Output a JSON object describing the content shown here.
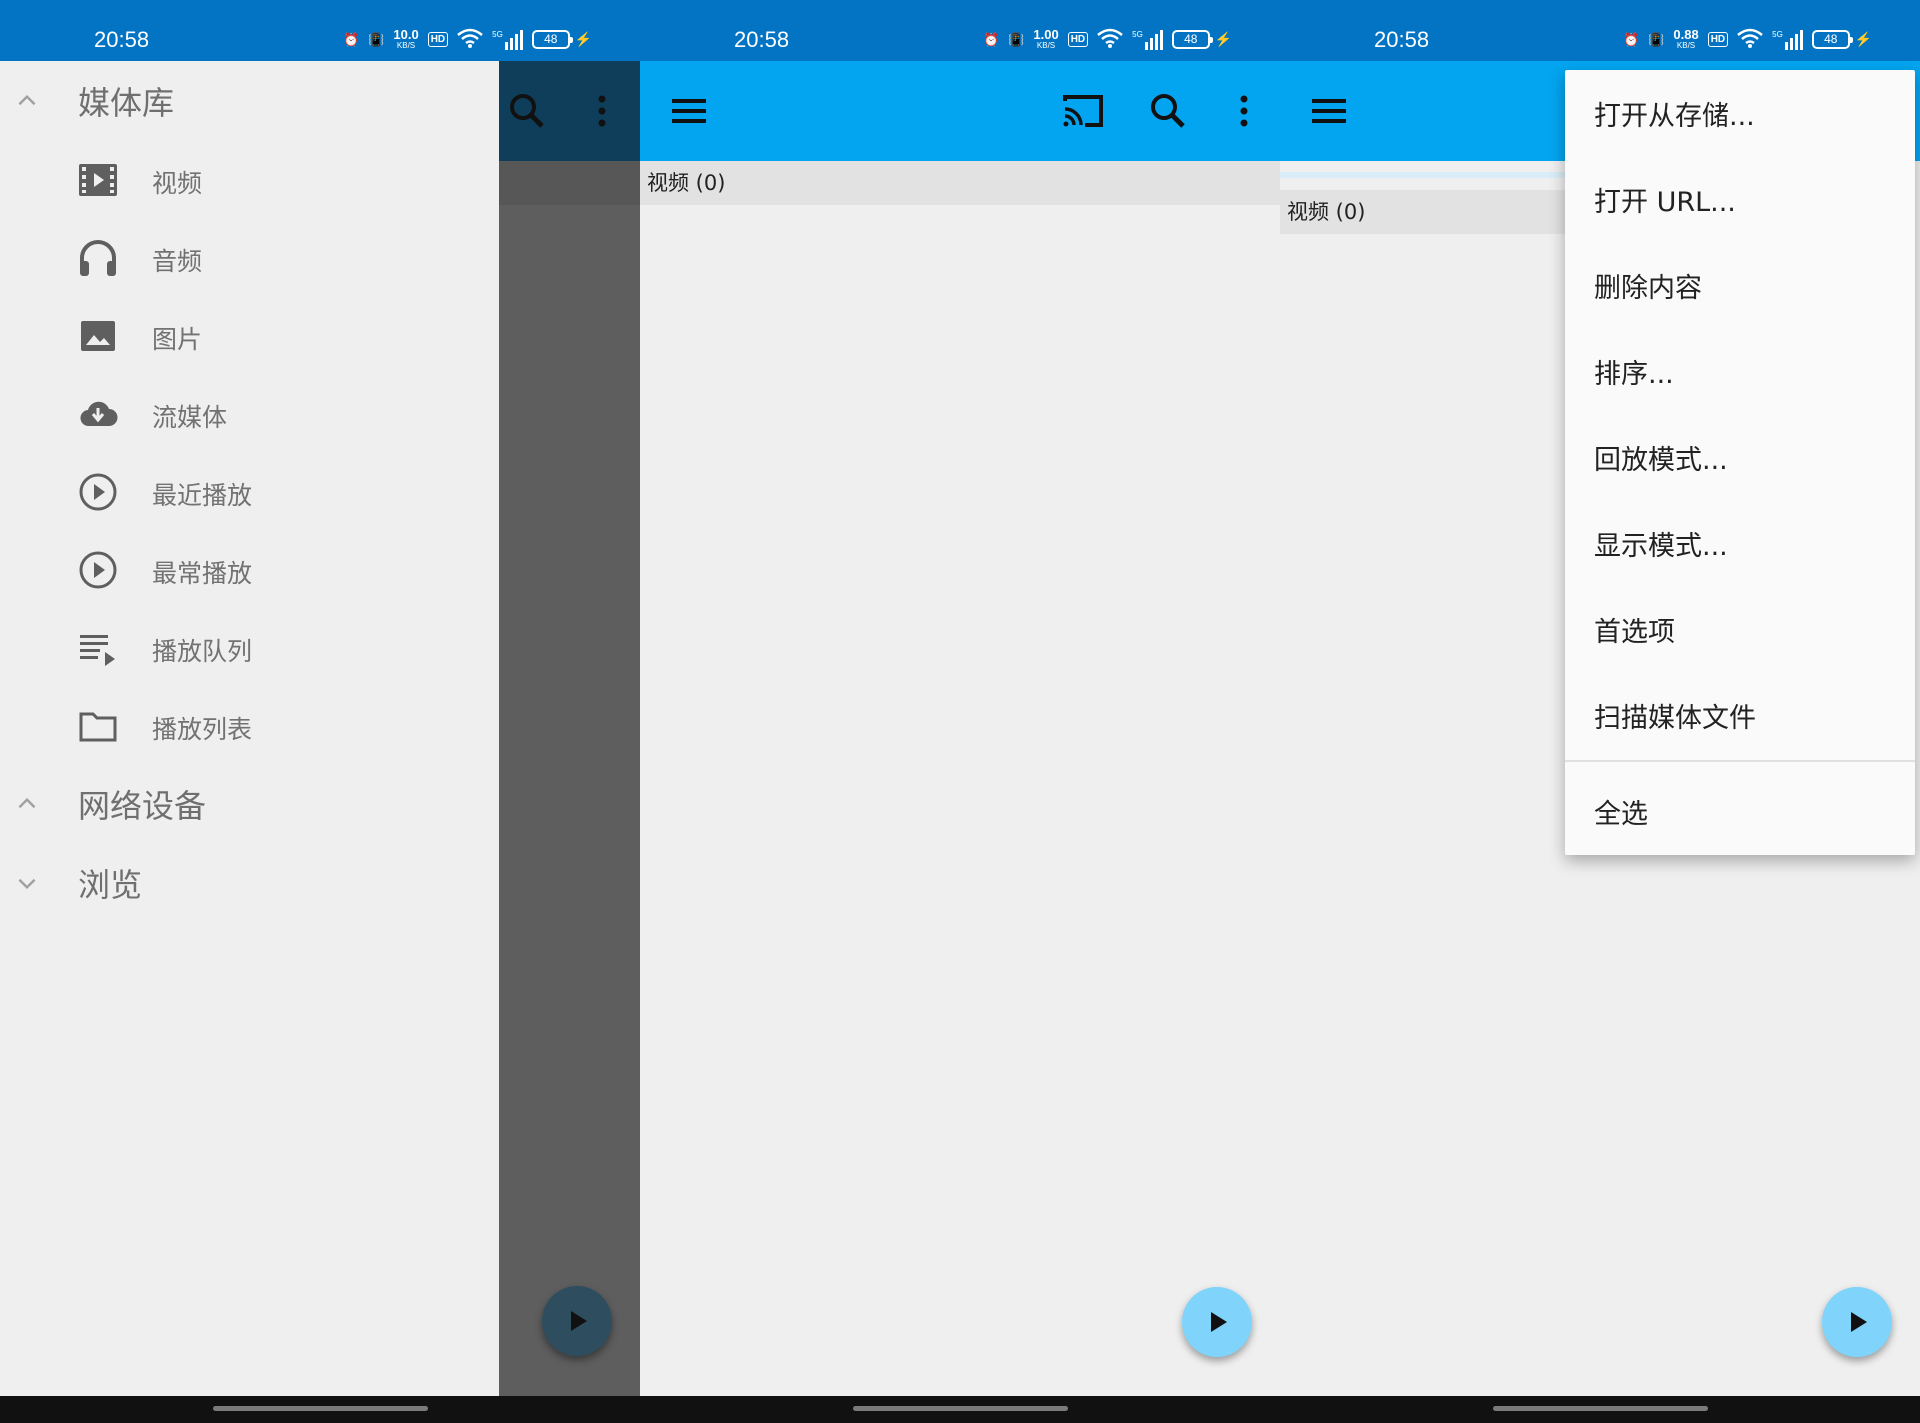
{
  "status": {
    "time": "20:58",
    "battery": "48",
    "speeds": [
      "10.0",
      "1.00",
      "0.88"
    ],
    "speed_unit": "KB/S",
    "hd": "HD",
    "signal": "5G"
  },
  "drawer": {
    "library_label": "媒体库",
    "items": [
      {
        "label": "视频",
        "icon": "video-icon"
      },
      {
        "label": "音频",
        "icon": "headphones-icon"
      },
      {
        "label": "图片",
        "icon": "image-icon"
      },
      {
        "label": "流媒体",
        "icon": "cloud-download-icon"
      },
      {
        "label": "最近播放",
        "icon": "play-circle-icon"
      },
      {
        "label": "最常播放",
        "icon": "play-circle-icon"
      },
      {
        "label": "播放队列",
        "icon": "queue-icon"
      },
      {
        "label": "播放列表",
        "icon": "folder-icon"
      }
    ],
    "network_label": "网络设备",
    "browse_label": "浏览"
  },
  "main": {
    "subheader": "视频 (0)"
  },
  "menu": {
    "items": [
      "打开从存储...",
      "打开 URL...",
      "删除内容",
      "排序...",
      "回放模式...",
      "显示模式...",
      "首选项",
      "扫描媒体文件"
    ],
    "select_all": "全选"
  },
  "colors": {
    "statusbar": "#0374c4",
    "toolbar": "#03a5f0",
    "fab": "#80d4fb",
    "background": "#efefef"
  }
}
